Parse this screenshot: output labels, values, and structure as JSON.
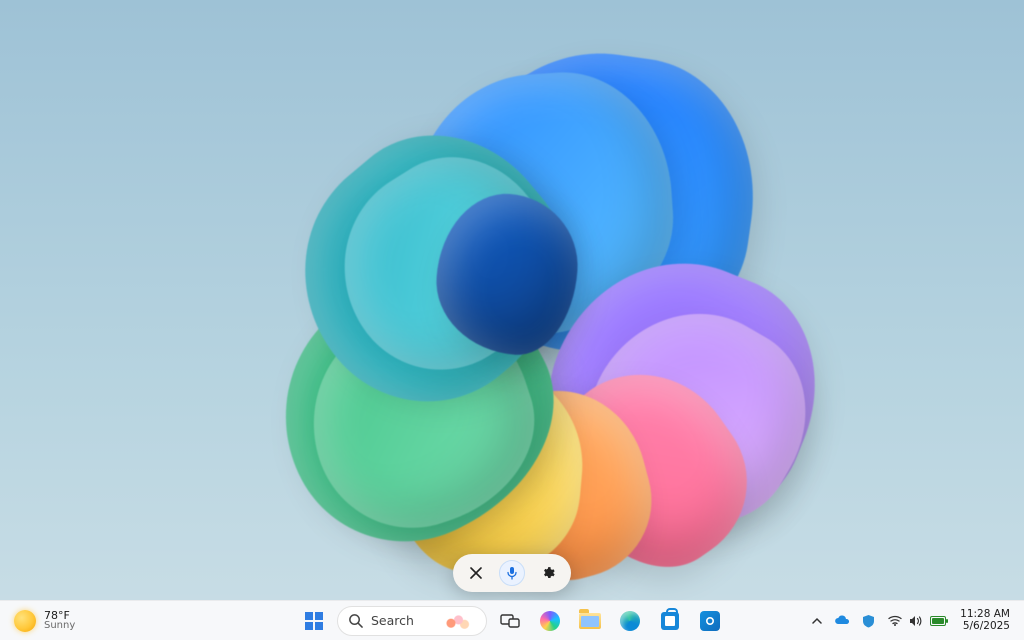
{
  "weather": {
    "temp": "78°F",
    "condition": "Sunny"
  },
  "search": {
    "placeholder": "Search"
  },
  "clock": {
    "time": "11:28 AM",
    "date": "5/6/2025"
  },
  "voice_pill": {
    "close_label": "Close",
    "mic_label": "Microphone",
    "settings_label": "Settings"
  },
  "taskbar_apps": {
    "start": "Start",
    "search": "Search",
    "task_view": "Task View",
    "copilot": "Copilot",
    "file_explorer": "File Explorer",
    "edge": "Microsoft Edge",
    "store": "Microsoft Store",
    "outlook": "Outlook"
  },
  "tray": {
    "overflow": "Show hidden icons",
    "onedrive": "OneDrive",
    "defender": "Windows Security",
    "wifi": "Wi-Fi",
    "volume": "Volume",
    "battery": "Battery"
  }
}
